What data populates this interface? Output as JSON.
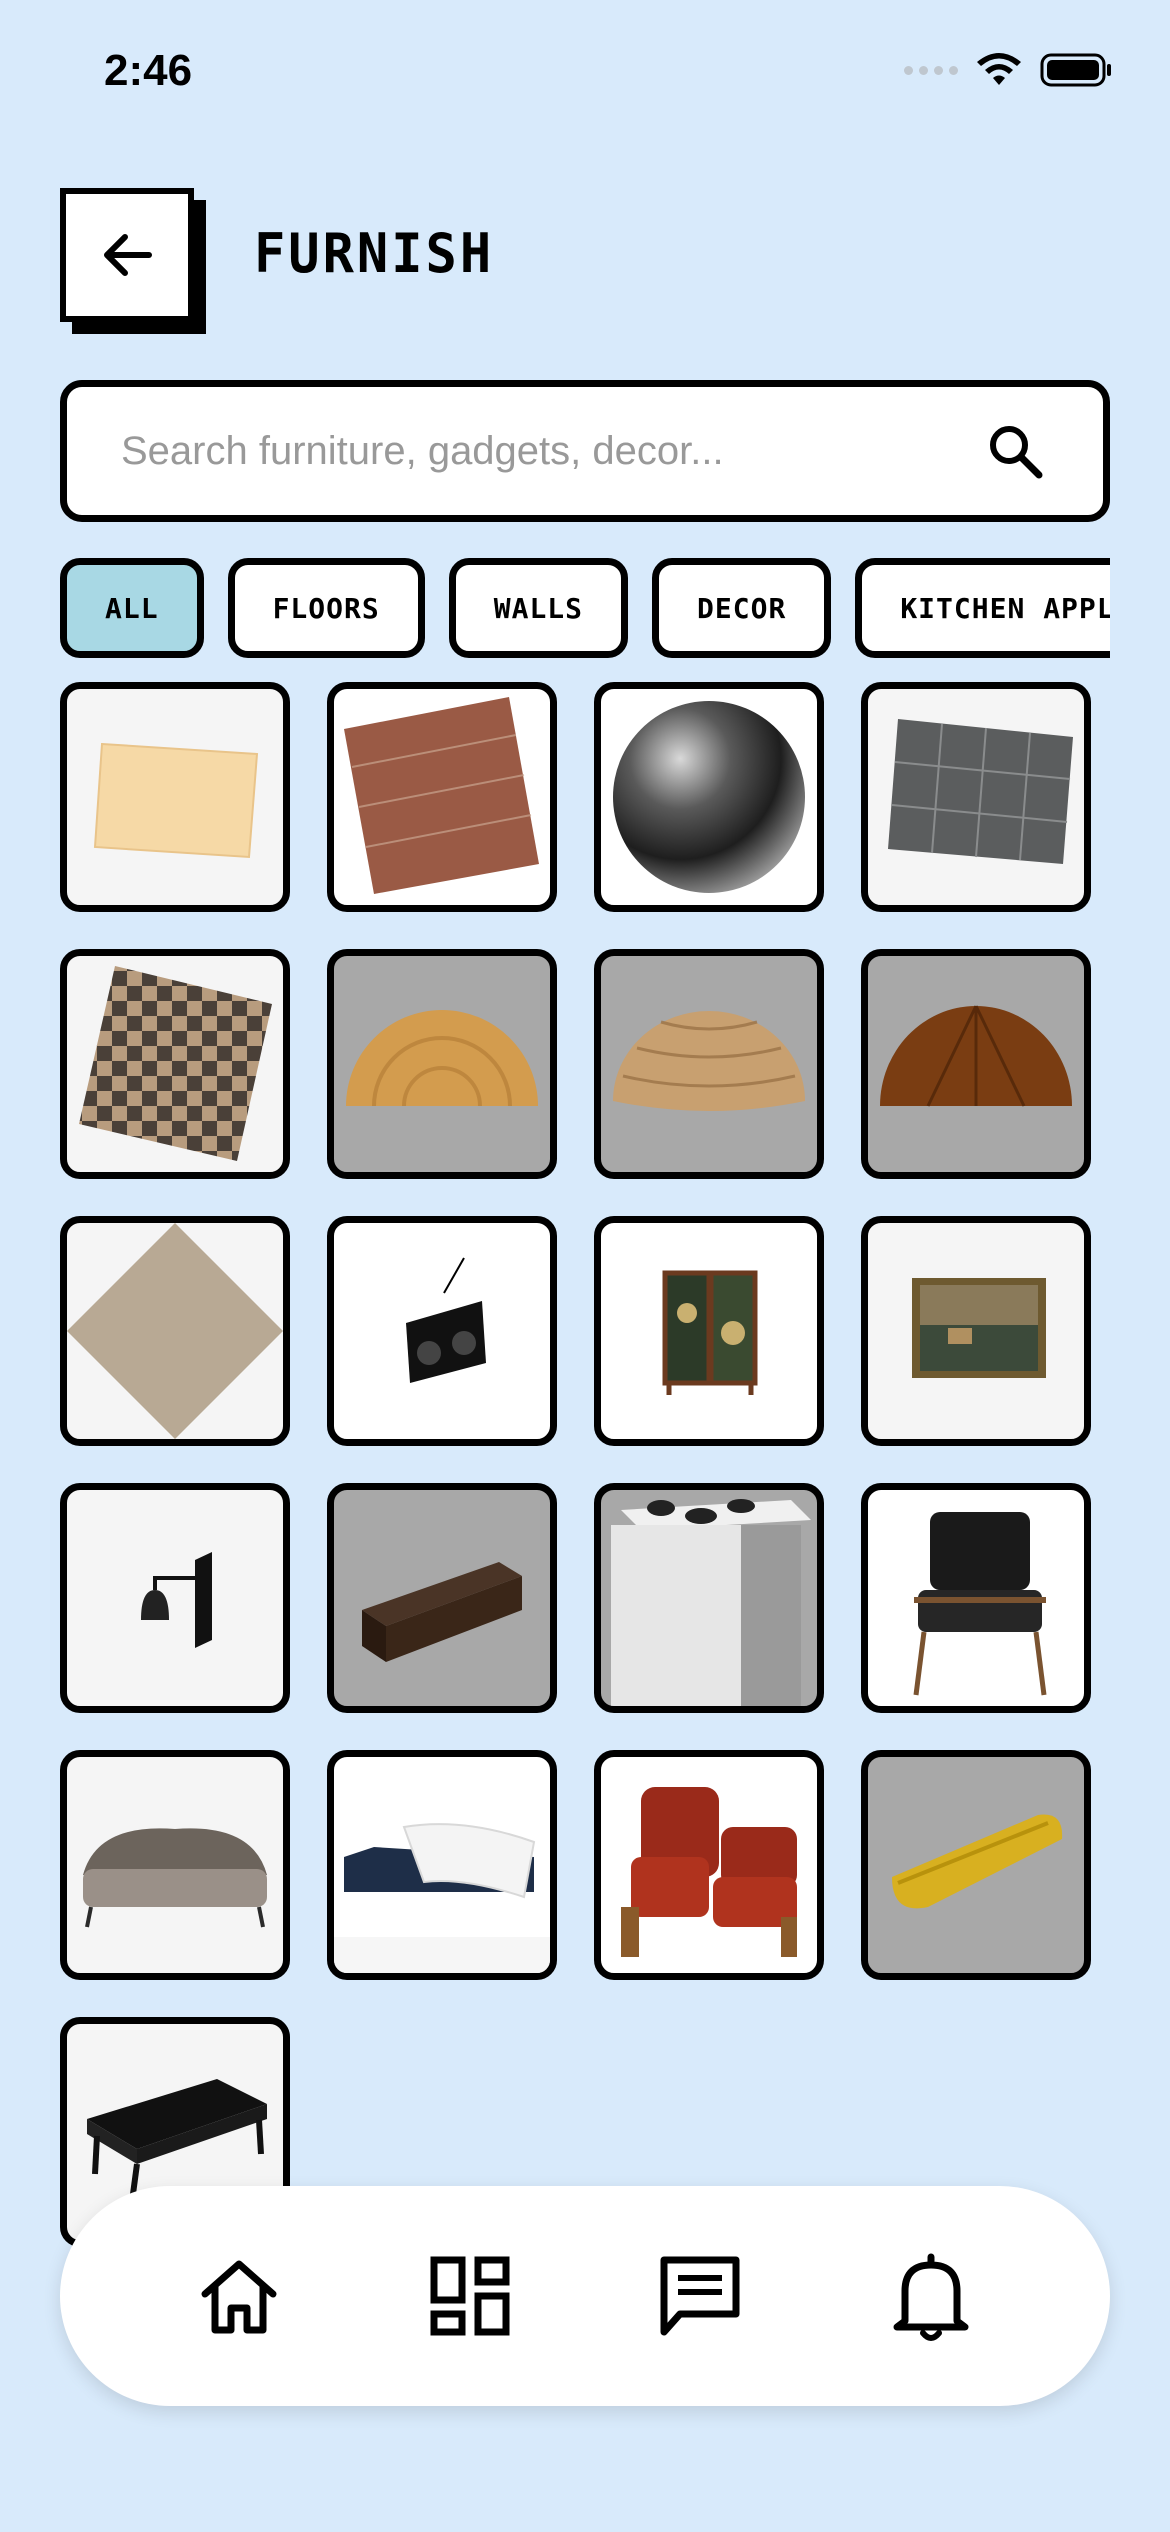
{
  "status_bar": {
    "time": "2:46"
  },
  "header": {
    "back_icon": "arrow-left-icon",
    "title": "FURNISH"
  },
  "search": {
    "placeholder": "Search furniture, gadgets, decor...",
    "value": "",
    "icon": "search-icon"
  },
  "categories": [
    {
      "label": "ALL",
      "active": true
    },
    {
      "label": "FLOORS",
      "active": false
    },
    {
      "label": "WALLS",
      "active": false
    },
    {
      "label": "DECOR",
      "active": false
    },
    {
      "label": "KITCHEN APPLIANCES",
      "active": false
    }
  ],
  "items": [
    {
      "kind": "light-wood-floor-tile",
      "background": "light"
    },
    {
      "kind": "brick-wall-tile",
      "background": "white"
    },
    {
      "kind": "chrome-sphere",
      "background": "white"
    },
    {
      "kind": "gray-stone-tile",
      "background": "light"
    },
    {
      "kind": "checker-floor-tile",
      "background": "light"
    },
    {
      "kind": "parquet-dome",
      "background": "gray"
    },
    {
      "kind": "wood-stripe-dome",
      "background": "gray"
    },
    {
      "kind": "dark-wood-dome",
      "background": "gray"
    },
    {
      "kind": "marble-floor-tile",
      "background": "light"
    },
    {
      "kind": "boombox",
      "background": "white"
    },
    {
      "kind": "folding-screen",
      "background": "white"
    },
    {
      "kind": "framed-painting",
      "background": "light"
    },
    {
      "kind": "wall-lamp",
      "background": "light"
    },
    {
      "kind": "tv-console",
      "background": "gray"
    },
    {
      "kind": "stove-appliance",
      "background": "gray"
    },
    {
      "kind": "leather-armchair",
      "background": "white"
    },
    {
      "kind": "victorian-sofa",
      "background": "light"
    },
    {
      "kind": "chaise-lounge",
      "background": "white"
    },
    {
      "kind": "red-chairs",
      "background": "white"
    },
    {
      "kind": "yellow-sofa",
      "background": "gray"
    },
    {
      "kind": "black-coffee-table",
      "background": "light"
    }
  ],
  "bottom_nav": [
    {
      "icon": "home-icon"
    },
    {
      "icon": "dashboard-icon"
    },
    {
      "icon": "chat-icon"
    },
    {
      "icon": "bell-icon"
    }
  ]
}
